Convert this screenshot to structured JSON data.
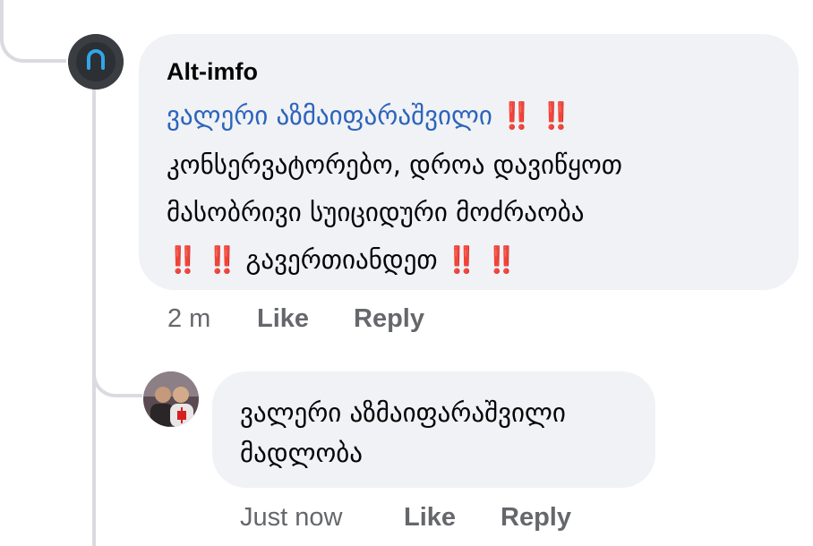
{
  "comment": {
    "author": "Alt-imfo",
    "mention": "ვალერი აზმაიფარაშვილი",
    "emphasis": "‼️ ‼️",
    "line1": "კონსერვატორებო, დროა დავიწყოთ",
    "line2": "მასობრივი სუიციდური მოძრაობა",
    "line3": "გავერთიანდეთ",
    "time": "2 m",
    "like": "Like",
    "reply": "Reply"
  },
  "reply": {
    "mention": "ვალერი აზმაიფარაშვილი",
    "text": "მადლობა",
    "time": "Just now",
    "like": "Like",
    "reply": "Reply"
  },
  "colors": {
    "bubble": "#f0f2f5",
    "mention": "#2d64bc",
    "emphasis": "#e0141e",
    "meta": "#65676b"
  }
}
